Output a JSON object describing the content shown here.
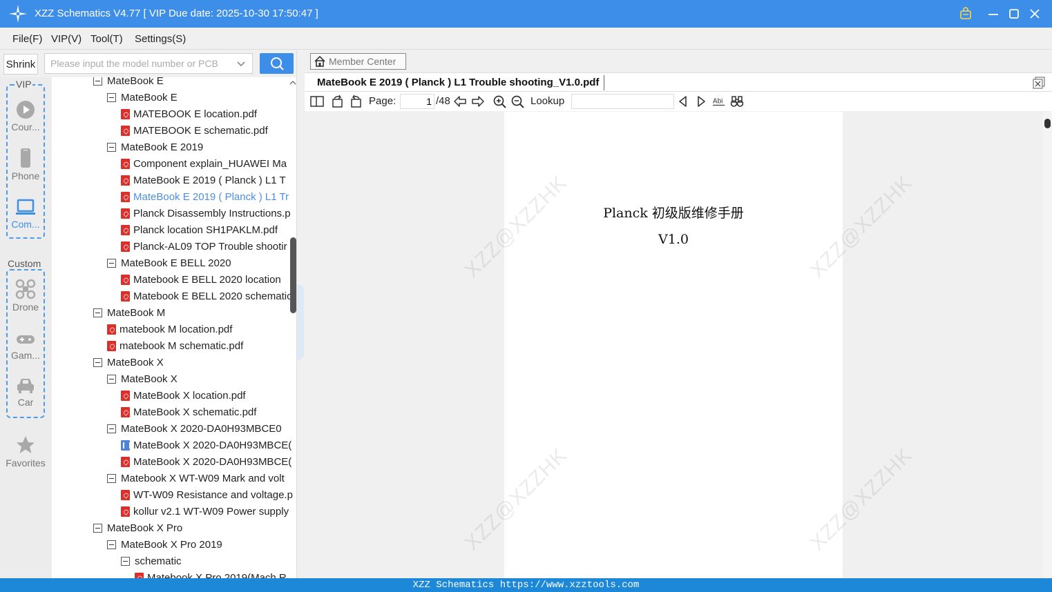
{
  "window": {
    "title": "XZZ Schematics V4.77 [ VIP Due date: 2025-10-30 17:50:47 ]",
    "icon": "xzz-logo-icon"
  },
  "menu": [
    "File(F)",
    "VIP(V)",
    "Tool(T)",
    "Settings(S)"
  ],
  "toolbar": {
    "shrink_label": "Shrink",
    "search_placeholder": "Please input the model number or PCB"
  },
  "categories": {
    "vip_label": "VIP",
    "custom_label": "Custom",
    "vip_items": [
      {
        "icon": "course-play-icon",
        "label": "Cour..."
      },
      {
        "icon": "phone-icon",
        "label": "Phone"
      },
      {
        "icon": "computer-icon",
        "label": "Com..."
      }
    ],
    "custom_items": [
      {
        "icon": "drone-icon",
        "label": "Drone"
      },
      {
        "icon": "gamepad-icon",
        "label": "Gam..."
      },
      {
        "icon": "car-icon",
        "label": "Car"
      }
    ],
    "favorites_label": "Favorites"
  },
  "tree": [
    {
      "level": 0,
      "type": "folder",
      "label": "MateBook E"
    },
    {
      "level": 1,
      "type": "folder",
      "label": "MateBook E"
    },
    {
      "level": 2,
      "type": "pdf",
      "label": "MATEBOOK E location.pdf"
    },
    {
      "level": 2,
      "type": "pdf",
      "label": "MATEBOOK E schematic.pdf"
    },
    {
      "level": 1,
      "type": "folder",
      "label": "MateBook E 2019"
    },
    {
      "level": 2,
      "type": "pdf",
      "label": "Component explain_HUAWEI Ma"
    },
    {
      "level": 2,
      "type": "pdf",
      "label": "MateBook E 2019 ( Planck )  L1 T"
    },
    {
      "level": 2,
      "type": "pdf",
      "label": "MateBook E 2019 ( Planck ) L1 Tr",
      "selected": true
    },
    {
      "level": 2,
      "type": "pdf",
      "label": "Planck Disassembly Instructions.p"
    },
    {
      "level": 2,
      "type": "pdf",
      "label": "Planck location SH1PAKLM.pdf"
    },
    {
      "level": 2,
      "type": "pdf",
      "label": "Planck-AL09 TOP Trouble shootir"
    },
    {
      "level": 1,
      "type": "folder",
      "label": "MateBook E BELL 2020"
    },
    {
      "level": 2,
      "type": "pdf",
      "label": "Matebook E  BELL 2020  location"
    },
    {
      "level": 2,
      "type": "pdf",
      "label": "Matebook E BELL 2020 schematic"
    },
    {
      "level": 0,
      "type": "folder",
      "label": "MateBook M"
    },
    {
      "level": 1,
      "type": "pdf",
      "label": "matebook M location.pdf"
    },
    {
      "level": 1,
      "type": "pdf",
      "label": "matebook M schematic.pdf"
    },
    {
      "level": 0,
      "type": "folder",
      "label": "MateBook X"
    },
    {
      "level": 1,
      "type": "folder",
      "label": "MateBook X"
    },
    {
      "level": 2,
      "type": "pdf",
      "label": "MateBook X location.pdf"
    },
    {
      "level": 2,
      "type": "pdf",
      "label": "MateBook X schematic.pdf"
    },
    {
      "level": 1,
      "type": "folder",
      "label": "MateBook X 2020-DA0H93MBCE0"
    },
    {
      "level": 2,
      "type": "bdv",
      "label": "MateBook X 2020-DA0H93MBCE("
    },
    {
      "level": 2,
      "type": "pdf",
      "label": "MateBook X 2020-DA0H93MBCE("
    },
    {
      "level": 1,
      "type": "folder",
      "label": "Matebook X WT-W09 Mark and volt"
    },
    {
      "level": 2,
      "type": "pdf",
      "label": "WT-W09 Resistance and voltage.p"
    },
    {
      "level": 2,
      "type": "pdf",
      "label": "kollur v2.1 WT-W09 Power supply"
    },
    {
      "level": 0,
      "type": "folder",
      "label": "MateBook X Pro"
    },
    {
      "level": 1,
      "type": "folder",
      "label": "MateBook X Pro 2019"
    },
    {
      "level": 2,
      "type": "folder",
      "label": "schematic"
    },
    {
      "level": 3,
      "type": "pdf",
      "label": "Matebook X Pro 2019(Mach R"
    }
  ],
  "member_center_label": "Member Center",
  "document": {
    "tab_title": "MateBook E 2019 ( Planck ) L1 Trouble shooting_V1.0.pdf",
    "page_label": "Page:",
    "page_current": "1",
    "page_total": "/48",
    "lookup_label": "Lookup",
    "page_title": "Planck 初级版维修手册",
    "page_version": "V1.0",
    "watermark": "XZZ@XZZHK"
  },
  "status": {
    "text": "XZZ Schematics https://www.xzztools.com"
  },
  "colors": {
    "titlebar": "#3d8ee8",
    "accent": "#4c8fe0",
    "pdf_icon": "#d9302c",
    "statusbar": "#1e88d8"
  }
}
